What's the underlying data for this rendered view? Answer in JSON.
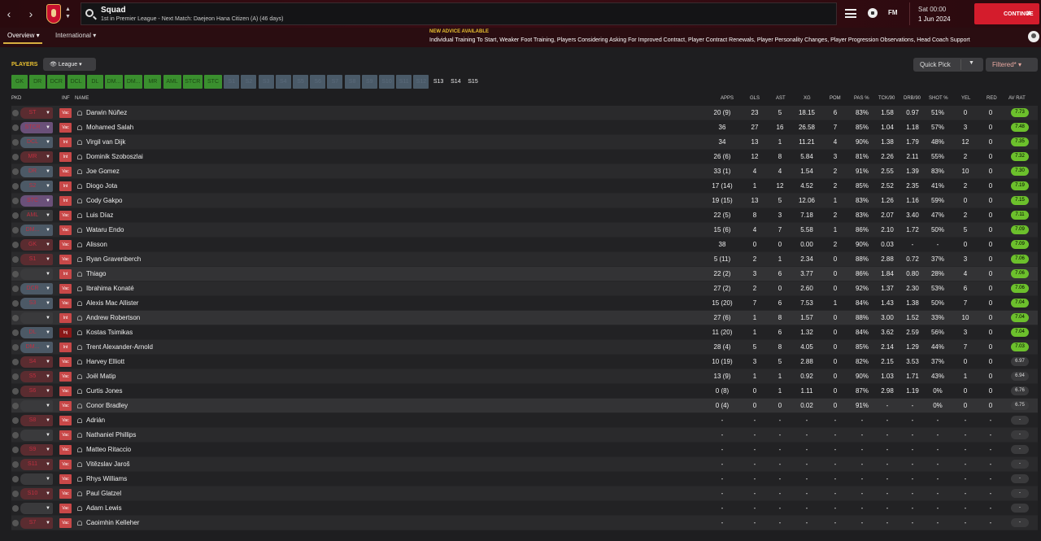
{
  "header": {
    "title": "Squad",
    "subtitle": "1st in Premier League - Next Match: Daejeon Hana Citizen (A) (46 days)",
    "time": "Sat 00:00",
    "date": "1 Jun 2024",
    "continue_label": "CONTINUE",
    "fm_logo": "FM"
  },
  "subnav": {
    "tab_overview": "Overview",
    "tab_international": "International"
  },
  "advice": {
    "title": "NEW ADVICE AVAILABLE",
    "text": "Individual Training To Start, Weaker Foot Training, Players Considering Asking For Improved Contract, Player Contract Renewals, Player Personality Changes, Player Progression Observations, Head Coach Support"
  },
  "toolbar": {
    "players_label": "PLAYERS",
    "league_select": "League",
    "quick_pick": "Quick Pick",
    "filtered": "Filtered*"
  },
  "position_tabs": [
    "GK",
    "DR",
    "DCR",
    "DCL",
    "DL",
    "DM...",
    "DM...",
    "MR",
    "AML",
    "STCR",
    "STC",
    "S1",
    "S2",
    "S3",
    "S4",
    "S5",
    "S6",
    "S7",
    "S8",
    "S9",
    "S10",
    "S11",
    "S12",
    "S13",
    "S14",
    "S15"
  ],
  "columns": {
    "pkd": "PKD",
    "inf": "INF",
    "name": "NAME",
    "apps": "APPS",
    "gls": "GLS",
    "ast": "AST",
    "xg": "XG",
    "pom": "POM",
    "pas": "PAS %",
    "tck": "TCK/90",
    "drb": "DRB/90",
    "shot": "SHOT %",
    "yel": "YEL",
    "red": "RED",
    "avrat": "AV RAT"
  },
  "players": [
    {
      "pkd": "ST",
      "inf": "Vac",
      "name": "Darwin Núñez",
      "apps": "20 (9)",
      "gls": "23",
      "ast": "5",
      "xg": "18.15",
      "pom": "6",
      "pas": "83%",
      "tck": "1.58",
      "drb": "0.97",
      "shot": "51%",
      "yel": "0",
      "red": "0",
      "rat": "7.73"
    },
    {
      "pkd": "STCR",
      "inf": "Vac",
      "name": "Mohamed Salah",
      "apps": "36",
      "gls": "27",
      "ast": "16",
      "xg": "26.58",
      "pom": "7",
      "pas": "85%",
      "tck": "1.04",
      "drb": "1.18",
      "shot": "57%",
      "yel": "3",
      "red": "0",
      "rat": "7.48"
    },
    {
      "pkd": "DCL",
      "inf": "Int",
      "name": "Virgil van Dijk",
      "apps": "34",
      "gls": "13",
      "ast": "1",
      "xg": "11.21",
      "pom": "4",
      "pas": "90%",
      "tck": "1.38",
      "drb": "1.79",
      "shot": "48%",
      "yel": "12",
      "red": "0",
      "rat": "7.35"
    },
    {
      "pkd": "MR",
      "inf": "Int",
      "name": "Dominik Szoboszlai",
      "apps": "26 (6)",
      "gls": "12",
      "ast": "8",
      "xg": "5.84",
      "pom": "3",
      "pas": "81%",
      "tck": "2.26",
      "drb": "2.11",
      "shot": "55%",
      "yel": "2",
      "red": "0",
      "rat": "7.32"
    },
    {
      "pkd": "DR",
      "inf": "Vac",
      "name": "Joe Gomez",
      "apps": "33 (1)",
      "gls": "4",
      "ast": "4",
      "xg": "1.54",
      "pom": "2",
      "pas": "91%",
      "tck": "2.55",
      "drb": "1.39",
      "shot": "83%",
      "yel": "10",
      "red": "0",
      "rat": "7.30"
    },
    {
      "pkd": "S2",
      "inf": "Int",
      "name": "Diogo Jota",
      "apps": "17 (14)",
      "gls": "1",
      "ast": "12",
      "xg": "4.52",
      "pom": "2",
      "pas": "85%",
      "tck": "2.52",
      "drb": "2.35",
      "shot": "41%",
      "yel": "2",
      "red": "0",
      "rat": "7.19"
    },
    {
      "pkd": "STC",
      "inf": "Int",
      "name": "Cody Gakpo",
      "apps": "19 (15)",
      "gls": "13",
      "ast": "5",
      "xg": "12.06",
      "pom": "1",
      "pas": "83%",
      "tck": "1.26",
      "drb": "1.16",
      "shot": "59%",
      "yel": "0",
      "red": "0",
      "rat": "7.15"
    },
    {
      "pkd": "AML",
      "inf": "Vac",
      "name": "Luis Díaz",
      "apps": "22 (5)",
      "gls": "8",
      "ast": "3",
      "xg": "7.18",
      "pom": "2",
      "pas": "83%",
      "tck": "2.07",
      "drb": "3.40",
      "shot": "47%",
      "yel": "2",
      "red": "0",
      "rat": "7.11"
    },
    {
      "pkd": "DM...",
      "inf": "Vac",
      "name": "Wataru Endo",
      "apps": "15 (6)",
      "gls": "4",
      "ast": "7",
      "xg": "5.58",
      "pom": "1",
      "pas": "86%",
      "tck": "2.10",
      "drb": "1.72",
      "shot": "50%",
      "yel": "5",
      "red": "0",
      "rat": "7.09"
    },
    {
      "pkd": "GK",
      "inf": "Vac",
      "name": "Alisson",
      "apps": "38",
      "gls": "0",
      "ast": "0",
      "xg": "0.00",
      "pom": "2",
      "pas": "90%",
      "tck": "0.03",
      "drb": "-",
      "shot": "-",
      "yel": "0",
      "red": "0",
      "rat": "7.09"
    },
    {
      "pkd": "S1",
      "inf": "Vac",
      "name": "Ryan Gravenberch",
      "apps": "5 (11)",
      "gls": "2",
      "ast": "1",
      "xg": "2.34",
      "pom": "0",
      "pas": "88%",
      "tck": "2.88",
      "drb": "0.72",
      "shot": "37%",
      "yel": "3",
      "red": "0",
      "rat": "7.06"
    },
    {
      "pkd": "",
      "inf": "Int",
      "name": "Thiago",
      "apps": "22 (2)",
      "gls": "3",
      "ast": "6",
      "xg": "3.77",
      "pom": "0",
      "pas": "86%",
      "tck": "1.84",
      "drb": "0.80",
      "shot": "28%",
      "yel": "4",
      "red": "0",
      "rat": "7.06"
    },
    {
      "pkd": "DCR",
      "inf": "Vac",
      "name": "Ibrahima Konaté",
      "apps": "27 (2)",
      "gls": "2",
      "ast": "0",
      "xg": "2.60",
      "pom": "0",
      "pas": "92%",
      "tck": "1.37",
      "drb": "2.30",
      "shot": "53%",
      "yel": "6",
      "red": "0",
      "rat": "7.06"
    },
    {
      "pkd": "S3",
      "inf": "Vac",
      "name": "Alexis Mac Allister",
      "apps": "15 (20)",
      "gls": "7",
      "ast": "6",
      "xg": "7.53",
      "pom": "1",
      "pas": "84%",
      "tck": "1.43",
      "drb": "1.38",
      "shot": "50%",
      "yel": "7",
      "red": "0",
      "rat": "7.04"
    },
    {
      "pkd": "",
      "inf": "Int",
      "name": "Andrew Robertson",
      "apps": "27 (6)",
      "gls": "1",
      "ast": "8",
      "xg": "1.57",
      "pom": "0",
      "pas": "88%",
      "tck": "3.00",
      "drb": "1.52",
      "shot": "33%",
      "yel": "10",
      "red": "0",
      "rat": "7.04"
    },
    {
      "pkd": "DL",
      "inf": "Inj",
      "name": "Kostas Tsimikas",
      "apps": "11 (20)",
      "gls": "1",
      "ast": "6",
      "xg": "1.32",
      "pom": "0",
      "pas": "84%",
      "tck": "3.62",
      "drb": "2.59",
      "shot": "56%",
      "yel": "3",
      "red": "0",
      "rat": "7.04"
    },
    {
      "pkd": "DM...",
      "inf": "Int",
      "name": "Trent Alexander-Arnold",
      "apps": "28 (4)",
      "gls": "5",
      "ast": "8",
      "xg": "4.05",
      "pom": "0",
      "pas": "85%",
      "tck": "2.14",
      "drb": "1.29",
      "shot": "44%",
      "yel": "7",
      "red": "0",
      "rat": "7.03"
    },
    {
      "pkd": "S4",
      "inf": "Vac",
      "name": "Harvey Elliott",
      "apps": "10 (19)",
      "gls": "3",
      "ast": "5",
      "xg": "2.88",
      "pom": "0",
      "pas": "82%",
      "tck": "2.15",
      "drb": "3.53",
      "shot": "37%",
      "yel": "0",
      "red": "0",
      "rat": "6.97"
    },
    {
      "pkd": "S5",
      "inf": "Vac",
      "name": "Joël Matip",
      "apps": "13 (9)",
      "gls": "1",
      "ast": "1",
      "xg": "0.92",
      "pom": "0",
      "pas": "90%",
      "tck": "1.03",
      "drb": "1.71",
      "shot": "43%",
      "yel": "1",
      "red": "0",
      "rat": "6.94"
    },
    {
      "pkd": "S6",
      "inf": "Vac",
      "name": "Curtis Jones",
      "apps": "0 (8)",
      "gls": "0",
      "ast": "1",
      "xg": "1.11",
      "pom": "0",
      "pas": "87%",
      "tck": "2.98",
      "drb": "1.19",
      "shot": "0%",
      "yel": "0",
      "red": "0",
      "rat": "6.76"
    },
    {
      "pkd": "",
      "inf": "Vac",
      "name": "Conor Bradley",
      "apps": "0 (4)",
      "gls": "0",
      "ast": "0",
      "xg": "0.02",
      "pom": "0",
      "pas": "91%",
      "tck": "-",
      "drb": "-",
      "shot": "0%",
      "yel": "0",
      "red": "0",
      "rat": "6.75"
    },
    {
      "pkd": "S8",
      "inf": "Vac",
      "name": "Adrián",
      "apps": "-",
      "gls": "-",
      "ast": "-",
      "xg": "-",
      "pom": "-",
      "pas": "-",
      "tck": "-",
      "drb": "-",
      "shot": "-",
      "yel": "-",
      "red": "-",
      "rat": "-"
    },
    {
      "pkd": "",
      "inf": "Vac",
      "name": "Nathaniel Phillips",
      "apps": "-",
      "gls": "-",
      "ast": "-",
      "xg": "-",
      "pom": "-",
      "pas": "-",
      "tck": "-",
      "drb": "-",
      "shot": "-",
      "yel": "-",
      "red": "-",
      "rat": "-"
    },
    {
      "pkd": "S9",
      "inf": "Vac",
      "name": "Matteo Ritaccio",
      "apps": "-",
      "gls": "-",
      "ast": "-",
      "xg": "-",
      "pom": "-",
      "pas": "-",
      "tck": "-",
      "drb": "-",
      "shot": "-",
      "yel": "-",
      "red": "-",
      "rat": "-"
    },
    {
      "pkd": "S11",
      "inf": "Vac",
      "name": "Vitězslav Jaroš",
      "apps": "-",
      "gls": "-",
      "ast": "-",
      "xg": "-",
      "pom": "-",
      "pas": "-",
      "tck": "-",
      "drb": "-",
      "shot": "-",
      "yel": "-",
      "red": "-",
      "rat": "-"
    },
    {
      "pkd": "",
      "inf": "Vac",
      "name": "Rhys Williams",
      "apps": "-",
      "gls": "-",
      "ast": "-",
      "xg": "-",
      "pom": "-",
      "pas": "-",
      "tck": "-",
      "drb": "-",
      "shot": "-",
      "yel": "-",
      "red": "-",
      "rat": "-"
    },
    {
      "pkd": "S10",
      "inf": "Vac",
      "name": "Paul Glatzel",
      "apps": "-",
      "gls": "-",
      "ast": "-",
      "xg": "-",
      "pom": "-",
      "pas": "-",
      "tck": "-",
      "drb": "-",
      "shot": "-",
      "yel": "-",
      "red": "-",
      "rat": "-"
    },
    {
      "pkd": "",
      "inf": "Vac",
      "name": "Adam Lewis",
      "apps": "-",
      "gls": "-",
      "ast": "-",
      "xg": "-",
      "pom": "-",
      "pas": "-",
      "tck": "-",
      "drb": "-",
      "shot": "-",
      "yel": "-",
      "red": "-",
      "rat": "-"
    },
    {
      "pkd": "S7",
      "inf": "Vac",
      "name": "Caoimhin Kelleher",
      "apps": "-",
      "gls": "-",
      "ast": "-",
      "xg": "-",
      "pom": "-",
      "pas": "-",
      "tck": "-",
      "drb": "-",
      "shot": "-",
      "yel": "-",
      "red": "-",
      "rat": "-"
    }
  ],
  "colors": {
    "accent_red": "#d41c2c",
    "gold": "#e8c030",
    "rating_green": "#6cc02c",
    "position_green": "#3a8f2e"
  }
}
